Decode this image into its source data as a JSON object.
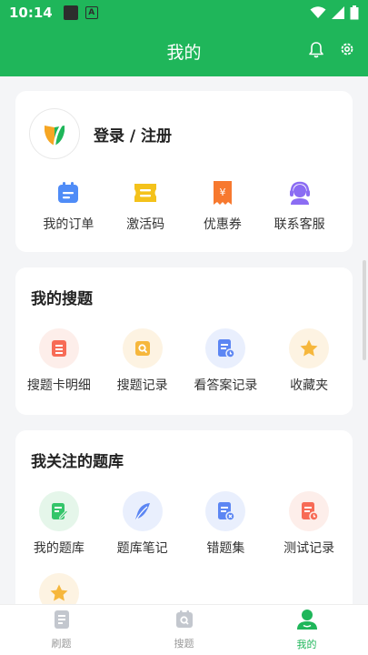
{
  "status_bar": {
    "time": "10:14",
    "a_icon": "A"
  },
  "header": {
    "title": "我的",
    "icons": [
      "bell-icon",
      "gear-icon"
    ]
  },
  "profile": {
    "login_label": "登录 / 注册",
    "logo": "app-logo-icon"
  },
  "quick_actions": [
    {
      "label": "我的订单",
      "icon": "calendar-order-icon",
      "color": "#4f8cf7"
    },
    {
      "label": "激活码",
      "icon": "ticket-icon",
      "color": "#f4c21b"
    },
    {
      "label": "优惠券",
      "icon": "coupon-icon",
      "color": "#f7792f"
    },
    {
      "label": "联系客服",
      "icon": "headset-icon",
      "color": "#8b6cf3"
    }
  ],
  "my_search": {
    "title": "我的搜题",
    "items": [
      {
        "label": "搜题卡明细",
        "icon": "list-card-icon",
        "bg": "#fdeeea",
        "color": "#f76b56"
      },
      {
        "label": "搜题记录",
        "icon": "search-record-icon",
        "bg": "#fdf3e2",
        "color": "#f6b73c"
      },
      {
        "label": "看答案记录",
        "icon": "answer-doc-icon",
        "bg": "#e9effd",
        "color": "#5c86f3"
      },
      {
        "label": "收藏夹",
        "icon": "star-icon",
        "bg": "#fdf3e2",
        "color": "#f6b73c"
      }
    ]
  },
  "followed_banks": {
    "title": "我关注的题库",
    "items": [
      {
        "label": "我的题库",
        "icon": "edit-doc-icon",
        "bg": "#e5f6ea",
        "color": "#34c56a"
      },
      {
        "label": "题库笔记",
        "icon": "feather-icon",
        "bg": "#e9effd",
        "color": "#5c86f3"
      },
      {
        "label": "错题集",
        "icon": "wrong-doc-icon",
        "bg": "#e9effd",
        "color": "#5c86f3"
      },
      {
        "label": "测试记录",
        "icon": "test-doc-icon",
        "bg": "#fdeeea",
        "color": "#f76b56"
      }
    ],
    "extra_icon": {
      "icon": "star-icon",
      "bg": "#fdf3e2",
      "color": "#f6b73c"
    }
  },
  "tab_bar": {
    "tabs": [
      {
        "label": "刷题",
        "icon": "practice-icon",
        "active": false
      },
      {
        "label": "搜题",
        "icon": "search-tab-icon",
        "active": false
      },
      {
        "label": "我的",
        "icon": "profile-icon",
        "active": true
      }
    ]
  },
  "colors": {
    "brand": "#1fb65a",
    "background": "#f4f5f7"
  }
}
